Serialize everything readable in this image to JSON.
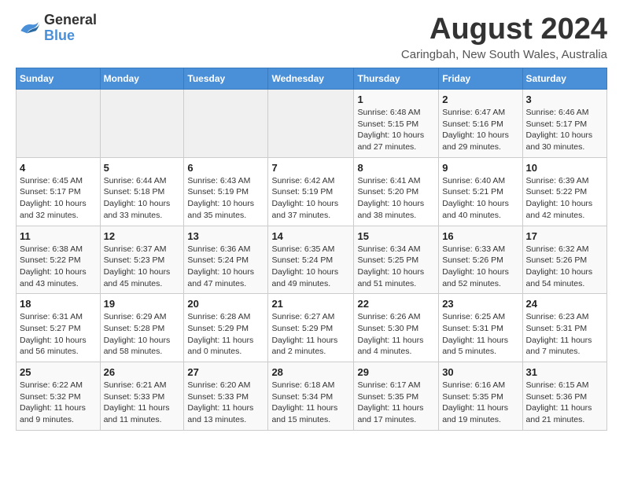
{
  "header": {
    "logo_general": "General",
    "logo_blue": "Blue",
    "main_title": "August 2024",
    "subtitle": "Caringbah, New South Wales, Australia"
  },
  "calendar": {
    "days_of_week": [
      "Sunday",
      "Monday",
      "Tuesday",
      "Wednesday",
      "Thursday",
      "Friday",
      "Saturday"
    ],
    "weeks": [
      [
        {
          "day": "",
          "detail": ""
        },
        {
          "day": "",
          "detail": ""
        },
        {
          "day": "",
          "detail": ""
        },
        {
          "day": "",
          "detail": ""
        },
        {
          "day": "1",
          "detail": "Sunrise: 6:48 AM\nSunset: 5:15 PM\nDaylight: 10 hours\nand 27 minutes."
        },
        {
          "day": "2",
          "detail": "Sunrise: 6:47 AM\nSunset: 5:16 PM\nDaylight: 10 hours\nand 29 minutes."
        },
        {
          "day": "3",
          "detail": "Sunrise: 6:46 AM\nSunset: 5:17 PM\nDaylight: 10 hours\nand 30 minutes."
        }
      ],
      [
        {
          "day": "4",
          "detail": "Sunrise: 6:45 AM\nSunset: 5:17 PM\nDaylight: 10 hours\nand 32 minutes."
        },
        {
          "day": "5",
          "detail": "Sunrise: 6:44 AM\nSunset: 5:18 PM\nDaylight: 10 hours\nand 33 minutes."
        },
        {
          "day": "6",
          "detail": "Sunrise: 6:43 AM\nSunset: 5:19 PM\nDaylight: 10 hours\nand 35 minutes."
        },
        {
          "day": "7",
          "detail": "Sunrise: 6:42 AM\nSunset: 5:19 PM\nDaylight: 10 hours\nand 37 minutes."
        },
        {
          "day": "8",
          "detail": "Sunrise: 6:41 AM\nSunset: 5:20 PM\nDaylight: 10 hours\nand 38 minutes."
        },
        {
          "day": "9",
          "detail": "Sunrise: 6:40 AM\nSunset: 5:21 PM\nDaylight: 10 hours\nand 40 minutes."
        },
        {
          "day": "10",
          "detail": "Sunrise: 6:39 AM\nSunset: 5:22 PM\nDaylight: 10 hours\nand 42 minutes."
        }
      ],
      [
        {
          "day": "11",
          "detail": "Sunrise: 6:38 AM\nSunset: 5:22 PM\nDaylight: 10 hours\nand 43 minutes."
        },
        {
          "day": "12",
          "detail": "Sunrise: 6:37 AM\nSunset: 5:23 PM\nDaylight: 10 hours\nand 45 minutes."
        },
        {
          "day": "13",
          "detail": "Sunrise: 6:36 AM\nSunset: 5:24 PM\nDaylight: 10 hours\nand 47 minutes."
        },
        {
          "day": "14",
          "detail": "Sunrise: 6:35 AM\nSunset: 5:24 PM\nDaylight: 10 hours\nand 49 minutes."
        },
        {
          "day": "15",
          "detail": "Sunrise: 6:34 AM\nSunset: 5:25 PM\nDaylight: 10 hours\nand 51 minutes."
        },
        {
          "day": "16",
          "detail": "Sunrise: 6:33 AM\nSunset: 5:26 PM\nDaylight: 10 hours\nand 52 minutes."
        },
        {
          "day": "17",
          "detail": "Sunrise: 6:32 AM\nSunset: 5:26 PM\nDaylight: 10 hours\nand 54 minutes."
        }
      ],
      [
        {
          "day": "18",
          "detail": "Sunrise: 6:31 AM\nSunset: 5:27 PM\nDaylight: 10 hours\nand 56 minutes."
        },
        {
          "day": "19",
          "detail": "Sunrise: 6:29 AM\nSunset: 5:28 PM\nDaylight: 10 hours\nand 58 minutes."
        },
        {
          "day": "20",
          "detail": "Sunrise: 6:28 AM\nSunset: 5:29 PM\nDaylight: 11 hours\nand 0 minutes."
        },
        {
          "day": "21",
          "detail": "Sunrise: 6:27 AM\nSunset: 5:29 PM\nDaylight: 11 hours\nand 2 minutes."
        },
        {
          "day": "22",
          "detail": "Sunrise: 6:26 AM\nSunset: 5:30 PM\nDaylight: 11 hours\nand 4 minutes."
        },
        {
          "day": "23",
          "detail": "Sunrise: 6:25 AM\nSunset: 5:31 PM\nDaylight: 11 hours\nand 5 minutes."
        },
        {
          "day": "24",
          "detail": "Sunrise: 6:23 AM\nSunset: 5:31 PM\nDaylight: 11 hours\nand 7 minutes."
        }
      ],
      [
        {
          "day": "25",
          "detail": "Sunrise: 6:22 AM\nSunset: 5:32 PM\nDaylight: 11 hours\nand 9 minutes."
        },
        {
          "day": "26",
          "detail": "Sunrise: 6:21 AM\nSunset: 5:33 PM\nDaylight: 11 hours\nand 11 minutes."
        },
        {
          "day": "27",
          "detail": "Sunrise: 6:20 AM\nSunset: 5:33 PM\nDaylight: 11 hours\nand 13 minutes."
        },
        {
          "day": "28",
          "detail": "Sunrise: 6:18 AM\nSunset: 5:34 PM\nDaylight: 11 hours\nand 15 minutes."
        },
        {
          "day": "29",
          "detail": "Sunrise: 6:17 AM\nSunset: 5:35 PM\nDaylight: 11 hours\nand 17 minutes."
        },
        {
          "day": "30",
          "detail": "Sunrise: 6:16 AM\nSunset: 5:35 PM\nDaylight: 11 hours\nand 19 minutes."
        },
        {
          "day": "31",
          "detail": "Sunrise: 6:15 AM\nSunset: 5:36 PM\nDaylight: 11 hours\nand 21 minutes."
        }
      ]
    ]
  }
}
